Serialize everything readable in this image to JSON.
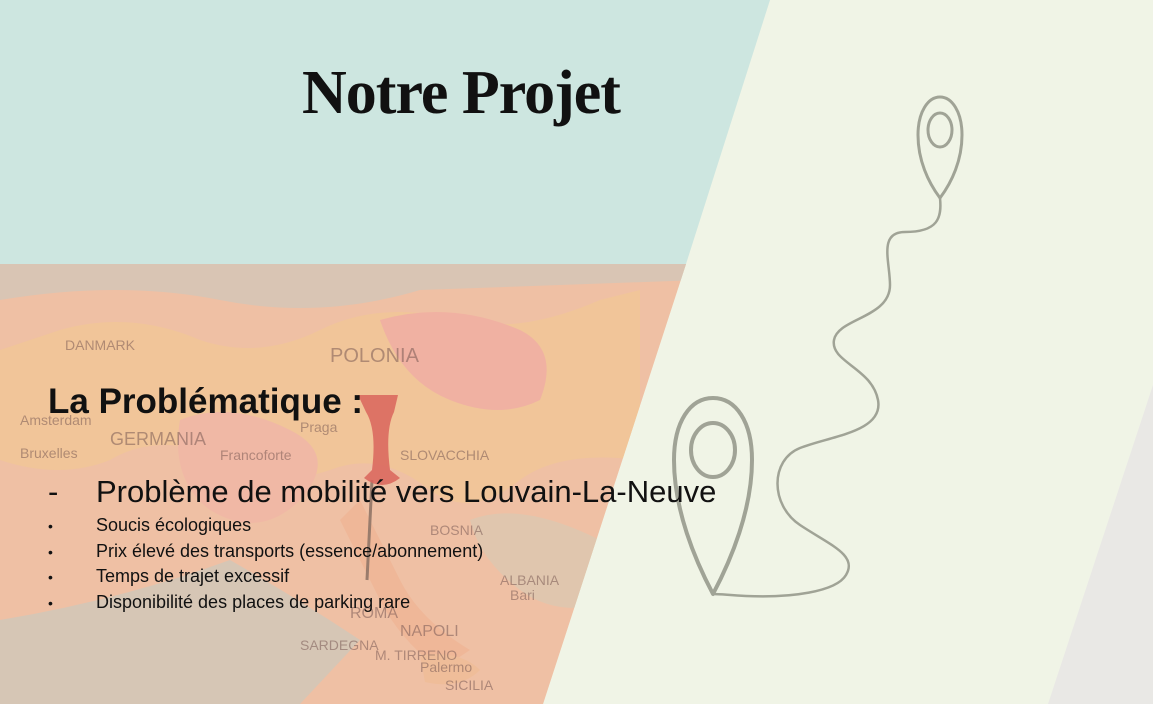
{
  "slide": {
    "title": "Notre Projet",
    "subtitle": "La Problématique :",
    "main_point": {
      "marker": "-",
      "text": "Problème de mobilité vers Louvain-La-Neuve"
    },
    "bullets": [
      {
        "marker": "•",
        "text": "Soucis écologiques"
      },
      {
        "marker": "•",
        "text": "Prix élevé des transports (essence/abonnement)"
      },
      {
        "marker": "•",
        "text": "Temps de trajet excessif"
      },
      {
        "marker": "•",
        "text": "Disponibilité des places de parking rare"
      }
    ],
    "map_labels": [
      "DANMARK",
      "POLONIA",
      "GERMANIA",
      "Praga",
      "Amsterdam",
      "Bruxelles",
      "Francoforte",
      "ROMA",
      "NAPOLI",
      "M. TIRRENO",
      "SARDEGNA",
      "Palermo",
      "SICILIA",
      "BOSNIA",
      "ALBANIA",
      "Bari",
      "SLOVACCHIA"
    ]
  },
  "colors": {
    "title_band": "#cde6e0",
    "map_overlay": "#eeb9a4",
    "right_panel": "#f0f4e6",
    "corner_gray": "#e9e8e5",
    "route_line": "#a0a396",
    "text": "#111111"
  },
  "icons": [
    "map-pin-large-icon",
    "map-pin-small-icon",
    "route-path",
    "push-pin-icon"
  ]
}
